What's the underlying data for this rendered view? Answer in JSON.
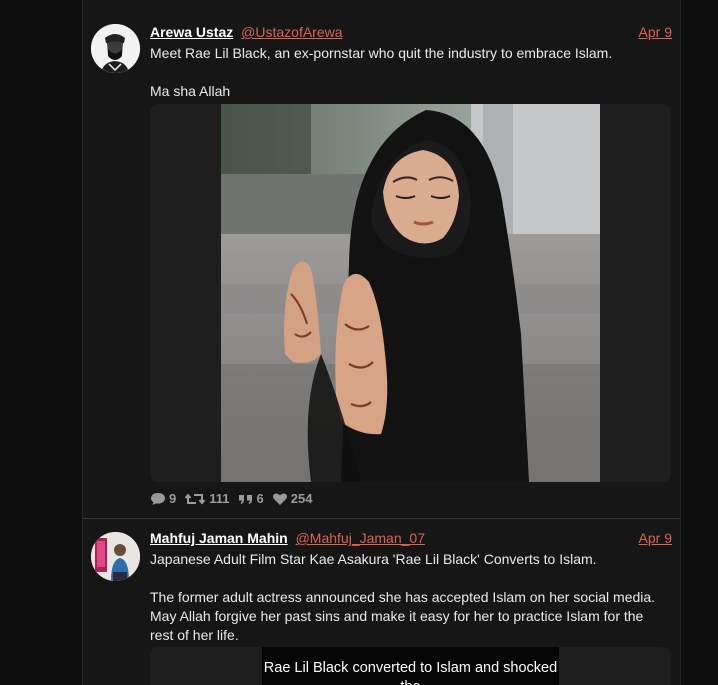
{
  "posts": [
    {
      "author_name": "Arewa Ustaz",
      "author_handle": "@UstazofArewa",
      "date": "Apr 9",
      "text": "Meet Rae Lil Black, an ex-pornstar who quit the industry to embrace Islam.\n\nMa sha Allah",
      "stats": {
        "replies": "9",
        "retweets": "111",
        "quotes": "6",
        "likes": "254"
      }
    },
    {
      "author_name": "Mahfuj Jaman Mahin",
      "author_handle": "@Mahfuj_Jaman_07",
      "date": "Apr 9",
      "text": "Japanese Adult Film Star Kae Asakura 'Rae Lil Black' Converts to Islam.\n\nThe former adult actress announced she has accepted Islam on her social media. May Allah forgive her past sins and make it easy for her to practice Islam for the rest of her life.",
      "embed_text": "Rae Lil Black converted to Islam and shocked the"
    }
  ],
  "icons": {
    "reply": "reply-icon",
    "retweet": "retweet-icon",
    "quote": "quote-icon",
    "like": "heart-icon"
  },
  "colors": {
    "background": "#0f0f0f",
    "card": "#161616",
    "link": "#e0624f",
    "text": "#eaeaea",
    "muted": "#9a9a9a"
  }
}
